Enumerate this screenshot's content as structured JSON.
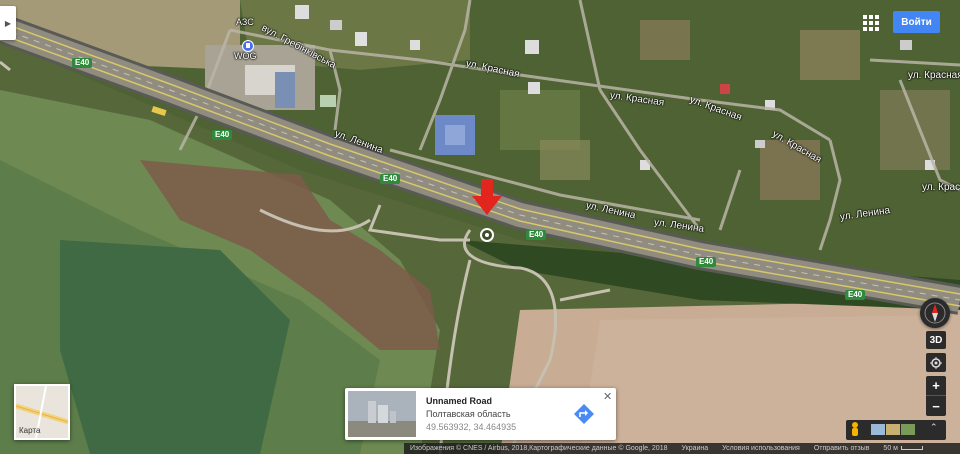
{
  "map": {
    "road_labels": {
      "azs": "АЗС",
      "wog": "WOG",
      "grebinkivska": "вул. Гребінківська",
      "krasnaya_1": "ул. Красная",
      "krasnaya_2": "ул. Красная",
      "krasnaya_3": "ул. Красная",
      "krasnaya_4": "ул. Красная",
      "krasnaya_5": "ул. Красная",
      "krasnaya_6": "ул. Красная",
      "lenina_1": "ул. Ленина",
      "lenina_2": "ул. Ленина",
      "lenina_3": "ул. Ленина",
      "lenina_4": "ул. Ленина"
    },
    "route_shields": [
      "E40",
      "E40",
      "E40",
      "E40",
      "E40",
      "E40"
    ]
  },
  "header": {
    "signin_label": "Войти"
  },
  "layer_switcher": {
    "label": "Карта"
  },
  "info_card": {
    "title": "Unnamed Road",
    "region": "Полтавская область",
    "coords": "49.563932, 34.464935"
  },
  "controls": {
    "tilt_label": "3D"
  },
  "footer": {
    "attribution": "Изображения © CNES / Airbus, 2018,Картографические данные © Google, 2018",
    "country": "Украина",
    "terms": "Условия использования",
    "feedback": "Отправить отзыв",
    "scale": "50 м"
  },
  "colors": {
    "signin": "#4285f4",
    "marker_arrow": "#e2261d",
    "route_shield": "#2f8a3c"
  }
}
